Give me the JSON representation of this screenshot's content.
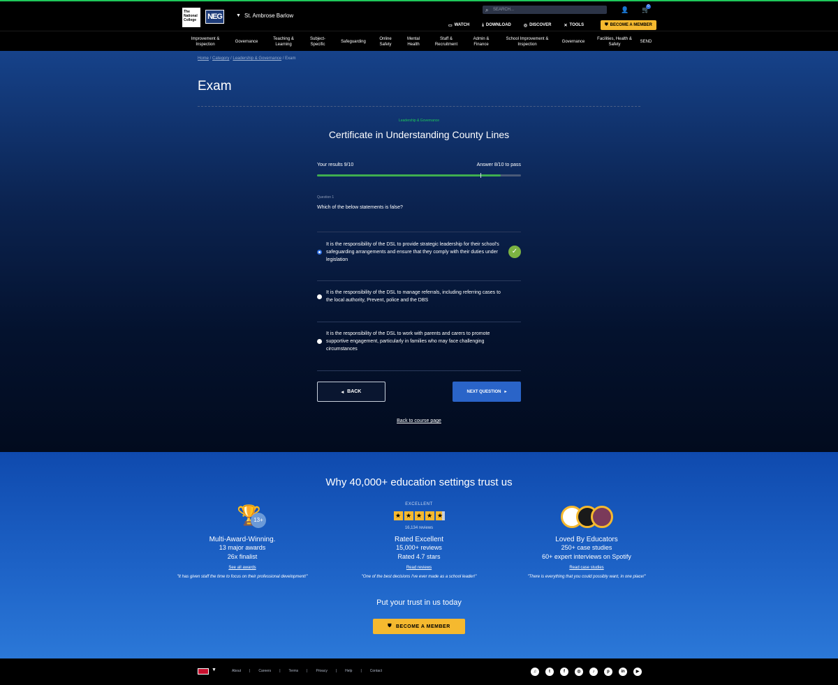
{
  "header": {
    "logo1": "The National College",
    "logo2": "NEG",
    "school": "St. Ambrose Barlow",
    "search_placeholder": "SEARCH...",
    "cart_count": "0",
    "links": [
      "WATCH",
      "DOWNLOAD",
      "DISCOVER",
      "TOOLS"
    ],
    "become_member": "BECOME A MEMBER"
  },
  "nav": {
    "items": [
      "Improvement & Inspection",
      "Governance",
      "Teaching & Learning",
      "Subject-Specific",
      "Safeguarding",
      "Online Safety",
      "Mental Health",
      "Staff & Recruitment",
      "Admin & Finance",
      "School Improvement & Inspection",
      "Governance",
      "Facilities, Health & Safety",
      "SEND"
    ]
  },
  "breadcrumb": [
    "Home",
    "Category",
    "Leadership & Governance",
    "Exam"
  ],
  "page_title": "Exam",
  "exam": {
    "category": "Leadership & Governance",
    "course_title": "Certificate in Understanding County Lines",
    "results": "Your results 9/10",
    "pass": "Answer 8/10 to pass",
    "progress_fraction": 0.9,
    "pass_fraction": 0.8,
    "question_number": "Question 1",
    "question": "Which of the below statements is false?",
    "options": [
      "It is the responsibility of the DSL to provide strategic leadership for their school's safeguarding arrangements and ensure that they comply with their duties under legislation",
      "It is the responsibility of the DSL to manage referrals, including referring cases to the local authority, Prevent, police and the DBS",
      "It is the responsibility of the DSL to work with parents and carers to promote supportive engagement, particularly in families who may face challenging circumstances"
    ],
    "selected_option": 0,
    "back": "BACK",
    "next": "NEXT QUESTION",
    "back_link": "Back to course page"
  },
  "trust": {
    "title": "Why 40,000+ education settings trust us",
    "col1": {
      "badge": "13+",
      "heading": "Multi-Award-Winning.",
      "line1": "13 major awards",
      "line2": "26x finalist",
      "link": "See all awards",
      "quote": "\"It has given staff the time to focus on their professional development!\""
    },
    "col2": {
      "excellent": "EXCELLENT",
      "reviews_count": "16,134 reviews",
      "rating_stars": 4.7,
      "heading": "Rated Excellent",
      "line1": "15,000+ reviews",
      "line2": "Rated 4.7 stars",
      "link": "Read reviews",
      "quote": "\"One of the best decisions I've ever made as a school leader!\""
    },
    "col3": {
      "heading": "Loved By Educators",
      "line1": "250+ case studies",
      "line2": "60+ expert interviews on Spotify",
      "link": "Read case studies",
      "quote": "\"There is everything that you could possibly want, in one place!\""
    },
    "cta_text": "Put your trust in us today",
    "cta_button": "BECOME A MEMBER"
  },
  "footer": {
    "links": [
      "About",
      "Careers",
      "Terms",
      "Privacy",
      "Help",
      "Contact"
    ],
    "socials": [
      "spotify-icon",
      "twitter-icon",
      "facebook-icon",
      "instagram-icon",
      "tiktok-icon",
      "pinterest-icon",
      "linkedin-icon",
      "youtube-icon"
    ]
  },
  "colors": {
    "accent_green": "#1ec85a",
    "member_yellow": "#f5b92f",
    "next_blue": "#2a64c8"
  }
}
